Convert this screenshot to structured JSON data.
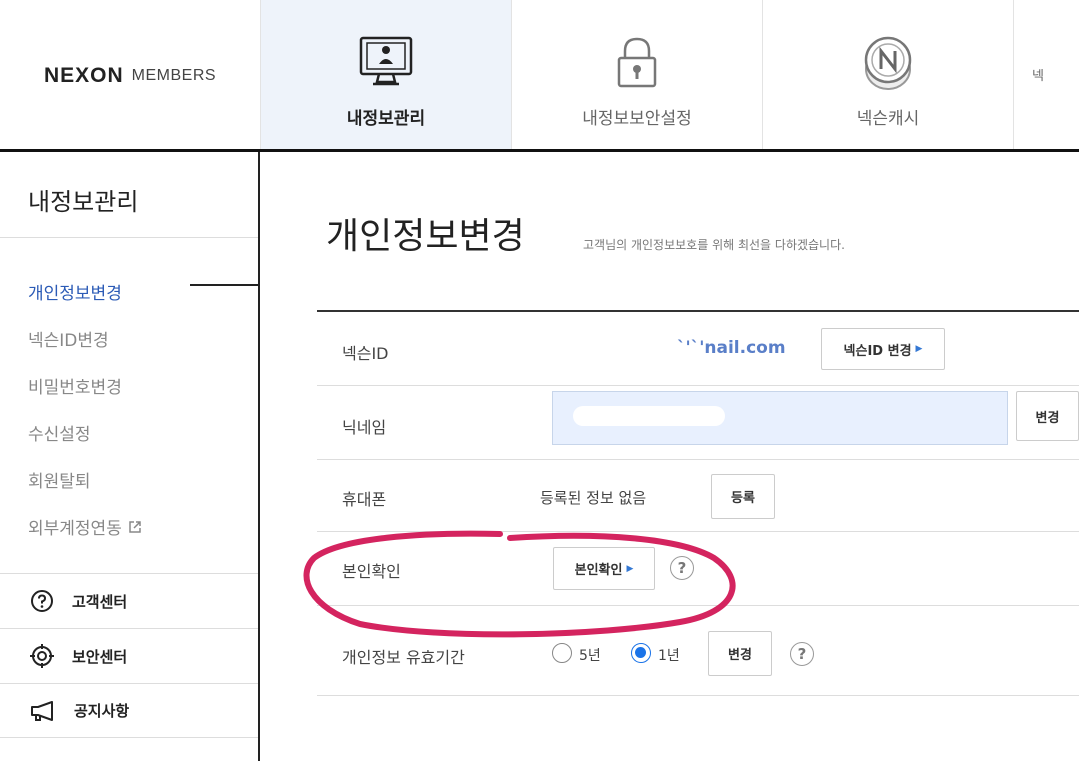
{
  "header": {
    "logo_main": "NEXON",
    "logo_sub": "MEMBERS",
    "tabs": [
      {
        "label": "내정보관리",
        "icon": "monitor-user-icon",
        "active": true
      },
      {
        "label": "내정보보안설정",
        "icon": "lock-icon",
        "active": false
      },
      {
        "label": "넥슨캐시",
        "icon": "nexon-coin-icon",
        "active": false
      },
      {
        "label": "넥",
        "icon": "",
        "active": false
      }
    ]
  },
  "sidebar": {
    "title": "내정보관리",
    "items": [
      {
        "label": "개인정보변경",
        "active": true
      },
      {
        "label": "넥슨ID변경"
      },
      {
        "label": "비밀번호변경"
      },
      {
        "label": "수신설정"
      },
      {
        "label": "회원탈퇴"
      },
      {
        "label": "외부계정연동",
        "ext_icon": "external-link-icon"
      }
    ],
    "links": [
      {
        "label": "고객센터",
        "icon": "question-circle-icon"
      },
      {
        "label": "보안센터",
        "icon": "target-icon"
      },
      {
        "label": "공지사항",
        "icon": "megaphone-icon"
      }
    ]
  },
  "main": {
    "title": "개인정보변경",
    "subtitle": "고객님의 개인정보보호를 위해 최선을 다하겠습니다.",
    "rows": {
      "nexon_id": {
        "label": "넥슨ID",
        "value": "`'`'nail.com",
        "button": "넥슨ID 변경"
      },
      "nickname": {
        "label": "닉네임",
        "value": "",
        "button": "변경"
      },
      "phone": {
        "label": "휴대폰",
        "value": "등록된 정보 없음",
        "button": "등록"
      },
      "identity": {
        "label": "본인확인",
        "button": "본인확인",
        "help": "?"
      },
      "validity": {
        "label": "개인정보 유효기간",
        "options": [
          "5년",
          "1년"
        ],
        "selected": "1년",
        "button": "변경",
        "help": "?"
      }
    }
  },
  "colors": {
    "active_blue": "#2c5bb6",
    "highlight": "#d4245f",
    "input_bg": "#e8f0fe"
  }
}
